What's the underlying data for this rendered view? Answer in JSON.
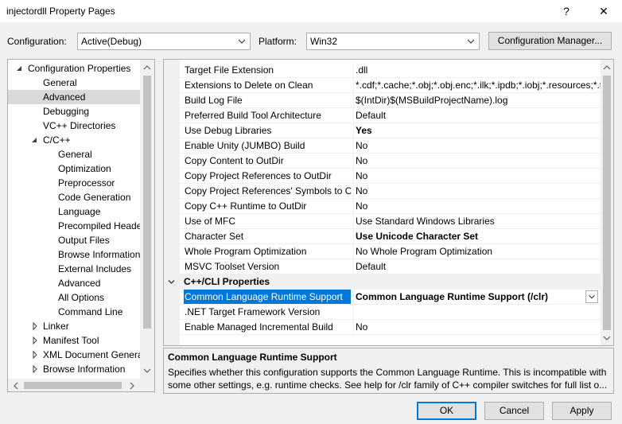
{
  "window": {
    "title": "injectordll Property Pages",
    "help_glyph": "?",
    "close_glyph": "✕"
  },
  "toolbar": {
    "configuration_label": "Configuration:",
    "configuration_value": "Active(Debug)",
    "platform_label": "Platform:",
    "platform_value": "Win32",
    "config_manager_label": "Configuration Manager..."
  },
  "tree": {
    "items": [
      {
        "label": "Configuration Properties",
        "level": 0,
        "expander": "expanded"
      },
      {
        "label": "General",
        "level": 1,
        "expander": "none"
      },
      {
        "label": "Advanced",
        "level": 1,
        "expander": "none",
        "selected": true
      },
      {
        "label": "Debugging",
        "level": 1,
        "expander": "none"
      },
      {
        "label": "VC++ Directories",
        "level": 1,
        "expander": "none"
      },
      {
        "label": "C/C++",
        "level": 1,
        "expander": "expanded"
      },
      {
        "label": "General",
        "level": 2,
        "expander": "none"
      },
      {
        "label": "Optimization",
        "level": 2,
        "expander": "none"
      },
      {
        "label": "Preprocessor",
        "level": 2,
        "expander": "none"
      },
      {
        "label": "Code Generation",
        "level": 2,
        "expander": "none"
      },
      {
        "label": "Language",
        "level": 2,
        "expander": "none"
      },
      {
        "label": "Precompiled Heade",
        "level": 2,
        "expander": "none"
      },
      {
        "label": "Output Files",
        "level": 2,
        "expander": "none"
      },
      {
        "label": "Browse Information",
        "level": 2,
        "expander": "none"
      },
      {
        "label": "External Includes",
        "level": 2,
        "expander": "none"
      },
      {
        "label": "Advanced",
        "level": 2,
        "expander": "none"
      },
      {
        "label": "All Options",
        "level": 2,
        "expander": "none"
      },
      {
        "label": "Command Line",
        "level": 2,
        "expander": "none"
      },
      {
        "label": "Linker",
        "level": 1,
        "expander": "collapsed"
      },
      {
        "label": "Manifest Tool",
        "level": 1,
        "expander": "collapsed"
      },
      {
        "label": "XML Document Genera",
        "level": 1,
        "expander": "collapsed"
      },
      {
        "label": "Browse Information",
        "level": 1,
        "expander": "collapsed"
      }
    ]
  },
  "grid": {
    "rows": [
      {
        "type": "prop",
        "name": "Target File Extension",
        "value": ".dll"
      },
      {
        "type": "prop",
        "name": "Extensions to Delete on Clean",
        "value": "*.cdf;*.cache;*.obj;*.obj.enc;*.ilk;*.ipdb;*.iobj;*.resources;*.t"
      },
      {
        "type": "prop",
        "name": "Build Log File",
        "value": "$(IntDir)$(MSBuildProjectName).log"
      },
      {
        "type": "prop",
        "name": "Preferred Build Tool Architecture",
        "value": "Default"
      },
      {
        "type": "prop",
        "name": "Use Debug Libraries",
        "value": "Yes",
        "bold": true
      },
      {
        "type": "prop",
        "name": "Enable Unity (JUMBO) Build",
        "value": "No"
      },
      {
        "type": "prop",
        "name": "Copy Content to OutDir",
        "value": "No"
      },
      {
        "type": "prop",
        "name": "Copy Project References to OutDir",
        "value": "No"
      },
      {
        "type": "prop",
        "name": "Copy Project References' Symbols to Ou",
        "value": "No"
      },
      {
        "type": "prop",
        "name": "Copy C++ Runtime to OutDir",
        "value": "No"
      },
      {
        "type": "prop",
        "name": "Use of MFC",
        "value": "Use Standard Windows Libraries"
      },
      {
        "type": "prop",
        "name": "Character Set",
        "value": "Use Unicode Character Set",
        "bold": true
      },
      {
        "type": "prop",
        "name": "Whole Program Optimization",
        "value": "No Whole Program Optimization"
      },
      {
        "type": "prop",
        "name": "MSVC Toolset Version",
        "value": "Default"
      },
      {
        "type": "category",
        "name": "C++/CLI Properties",
        "value": ""
      },
      {
        "type": "prop",
        "name": "Common Language Runtime Support",
        "value": "Common Language Runtime Support (/clr)",
        "selected": true
      },
      {
        "type": "prop",
        "name": ".NET Target Framework Version",
        "value": ""
      },
      {
        "type": "prop",
        "name": "Enable Managed Incremental Build",
        "value": "No"
      }
    ]
  },
  "description": {
    "title": "Common Language Runtime Support",
    "line1": "Specifies whether this configuration supports the Common Language Runtime. This is incompatible with",
    "line2": "some other settings, e.g. runtime checks. See help for /clr family of C++ compiler switches for full list o..."
  },
  "buttons": {
    "ok": "OK",
    "cancel": "Cancel",
    "apply": "Apply"
  },
  "colors": {
    "selection": "#0078d7",
    "tree_selected": "#d9d9d9",
    "border": "#adadad"
  }
}
